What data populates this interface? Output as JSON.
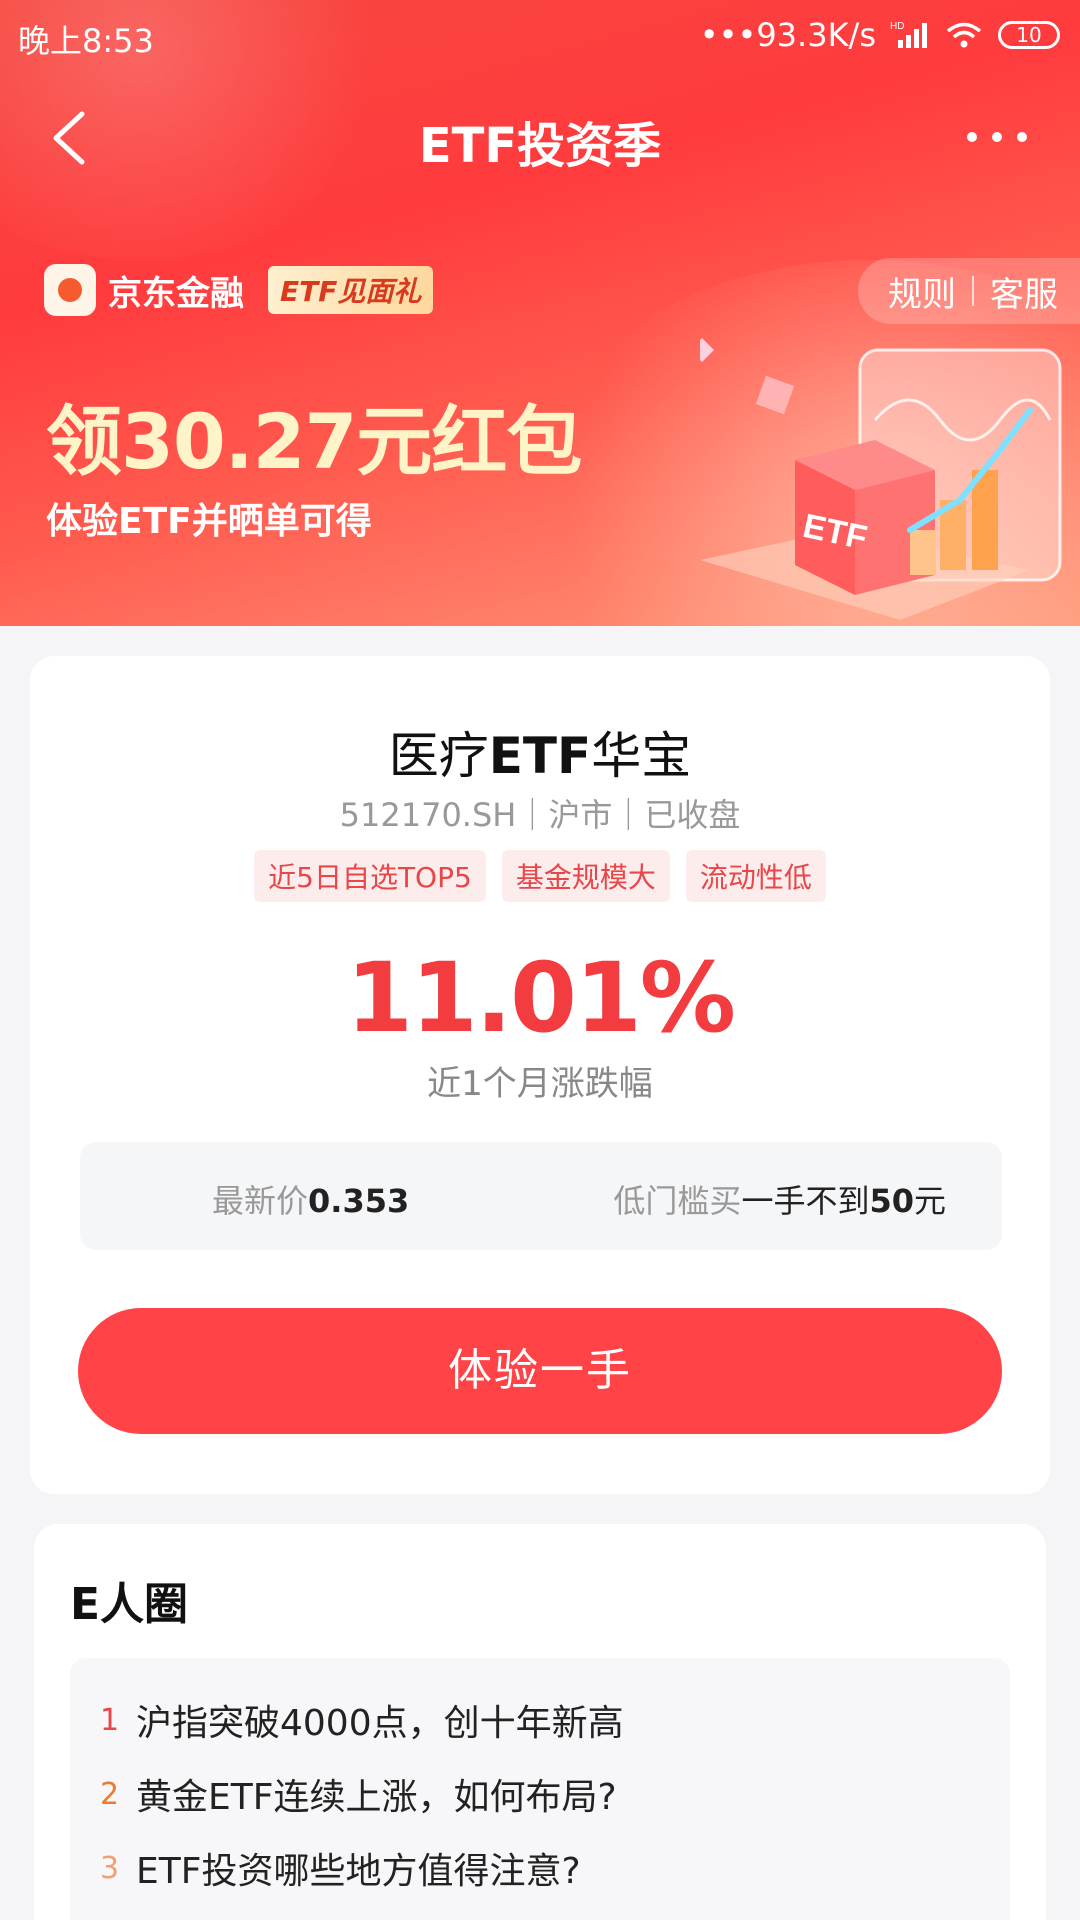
{
  "status": {
    "time": "晚上8:53",
    "speed": "93.3K/s",
    "battery": "10",
    "network": "HD"
  },
  "nav": {
    "title": "ETF投资季"
  },
  "banner": {
    "brand_name": "京东金融",
    "brand_tag": "ETF见面礼",
    "rules_label": "规则",
    "service_label": "客服",
    "headline": "领30.27元红包",
    "subline": "体验ETF并晒单可得",
    "art_label": "ETF"
  },
  "product": {
    "name_prefix": "医疗",
    "name_bold": "ETF",
    "name_suffix": "华宝",
    "code_line": "512170.SH｜沪市｜已收盘",
    "tags": [
      "近5日自选TOP5",
      "基金规模大",
      "流动性低"
    ],
    "change_pct": "11.01%",
    "change_label": "近1个月涨跌幅",
    "price_label": "最新价",
    "price_value": "0.353",
    "threshold_label": "低门槛买",
    "threshold_text1": "一手不到",
    "threshold_value": "50",
    "threshold_unit": "元",
    "cta_label": "体验一手"
  },
  "epeople": {
    "title": "E人圈",
    "items": [
      {
        "rank": "1",
        "text": "沪指突破4000点，创十年新高",
        "color": "#e8474a"
      },
      {
        "rank": "2",
        "text": "黄金ETF连续上涨，如何布局?",
        "color": "#f07a2e"
      },
      {
        "rank": "3",
        "text": "ETF投资哪些地方值得注意?",
        "color": "#f2a070"
      }
    ]
  }
}
